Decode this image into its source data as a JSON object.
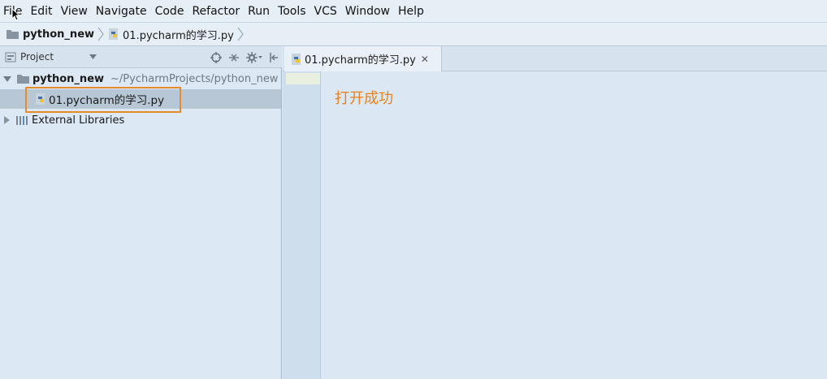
{
  "menu": [
    "File",
    "Edit",
    "View",
    "Navigate",
    "Code",
    "Refactor",
    "Run",
    "Tools",
    "VCS",
    "Window",
    "Help"
  ],
  "breadcrumb": {
    "project": "python_new",
    "file": "01.pycharm的学习.py"
  },
  "project_tool_window": {
    "title": "Project",
    "icons": [
      "locate-icon",
      "collapse-icon",
      "gear-icon",
      "hide-icon"
    ]
  },
  "tree": {
    "root_name": "python_new",
    "root_path": "~/PycharmProjects/python_new",
    "file": "01.pycharm的学习.py",
    "external": "External Libraries"
  },
  "editor": {
    "tab_label": "01.pycharm的学习.py",
    "content": "打开成功"
  },
  "colors": {
    "annotation": "#e68a2a",
    "editor_text": "#e8821e"
  }
}
